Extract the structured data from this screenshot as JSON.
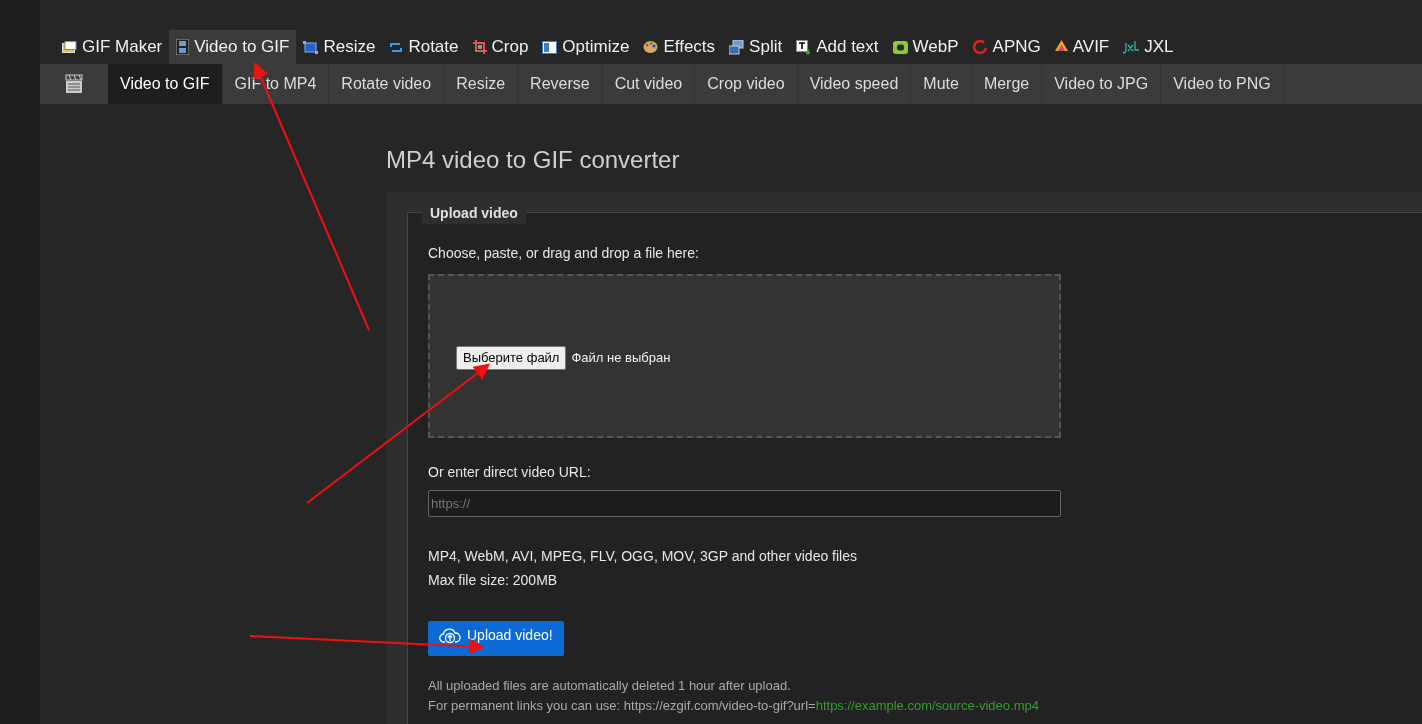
{
  "top_menu": [
    {
      "label": "GIF Maker",
      "selected": false
    },
    {
      "label": "Video to GIF",
      "selected": true
    },
    {
      "label": "Resize",
      "selected": false
    },
    {
      "label": "Rotate",
      "selected": false
    },
    {
      "label": "Crop",
      "selected": false
    },
    {
      "label": "Optimize",
      "selected": false
    },
    {
      "label": "Effects",
      "selected": false
    },
    {
      "label": "Split",
      "selected": false
    },
    {
      "label": "Add text",
      "selected": false
    },
    {
      "label": "WebP",
      "selected": false
    },
    {
      "label": "APNG",
      "selected": false
    },
    {
      "label": "AVIF",
      "selected": false
    },
    {
      "label": "JXL",
      "selected": false
    }
  ],
  "sub_menu": [
    {
      "label": "Video to GIF",
      "selected": true
    },
    {
      "label": "GIF to MP4",
      "selected": false
    },
    {
      "label": "Rotate video",
      "selected": false
    },
    {
      "label": "Resize",
      "selected": false
    },
    {
      "label": "Reverse",
      "selected": false
    },
    {
      "label": "Cut video",
      "selected": false
    },
    {
      "label": "Crop video",
      "selected": false
    },
    {
      "label": "Video speed",
      "selected": false
    },
    {
      "label": "Mute",
      "selected": false
    },
    {
      "label": "Merge",
      "selected": false
    },
    {
      "label": "Video to JPG",
      "selected": false
    },
    {
      "label": "Video to PNG",
      "selected": false
    }
  ],
  "page_title": "MP4 video to GIF converter",
  "upload": {
    "legend": "Upload video",
    "drop_label": "Choose, paste, or drag and drop a file here:",
    "file_button": "Выберите файл",
    "file_status": "Файл не выбран",
    "url_label": "Or enter direct video URL:",
    "url_placeholder": "https://",
    "formats": "MP4, WebM, AVI, MPEG, FLV, OGG, MOV, 3GP and other video files",
    "max_size": "Max file size: 200MB",
    "submit": "Upload video!",
    "note": "All uploaded files are automatically deleted 1 hour after upload.",
    "permalink_prefix": "For permanent links you can use: https://ezgif.com/video-to-gif?url=",
    "permalink_example": "https://example.com/source-video.mp4"
  }
}
